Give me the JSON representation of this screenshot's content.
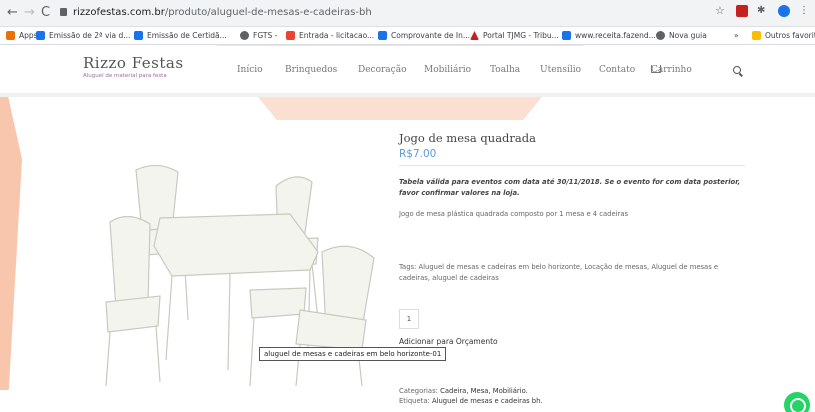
{
  "browser": {
    "url_domain": "rizzofestas.com.br",
    "url_path": "/produto/aluguel-de-mesas-e-cadeiras-bh",
    "bookmarks": [
      {
        "label": "Apps",
        "color": "#4285f4"
      },
      {
        "label": "Emissão de 2ª via d...",
        "color": "#1a73e8"
      },
      {
        "label": "Emissão de Certidã...",
        "color": "#1a73e8"
      },
      {
        "label": "FGTS -",
        "color": "#5f6368"
      },
      {
        "label": "Entrada - licitacao...",
        "color": "#ea4335"
      },
      {
        "label": "Comprovante de In...",
        "color": "#1a73e8"
      },
      {
        "label": "Portal TJMG - Tribu...",
        "color": "#c5221f"
      },
      {
        "label": "www.receita.fazend...",
        "color": "#1a73e8"
      },
      {
        "label": "Nova guia",
        "color": "#5f6368"
      },
      {
        "label": "»",
        "color": "#5f6368"
      },
      {
        "label": "Outros favoritos",
        "color": "#fbbc04"
      }
    ]
  },
  "site": {
    "logo_text": "Rizzo Festas",
    "logo_tagline": "Aluguel de material para festa",
    "menu": [
      "Início",
      "Brinquedos",
      "Decoração",
      "Mobiliário",
      "Toalha",
      "Utensílio",
      "Contato",
      "Carrinho"
    ]
  },
  "product": {
    "title": "Jogo de mesa quadrada",
    "price": "R$7.00",
    "notice": "Tabela válida para eventos com data até 30/11/2018. Se o evento for com data posterior, favor confirmar valores na loja.",
    "description": "Jogo de mesa plástica quadrada composto por 1 mesa e 4 cadeiras",
    "tags": "Tags: Aluguel de mesas e cadeiras em belo horizonte, Locação de mesas, Aluguel de mesas e cadeiras, aluguel de cadeiras",
    "quantity": "1",
    "add_label": "Adicionar para Orçamento",
    "tooltip": "aluguel de mesas e cadeiras em belo horizonte-01",
    "categories_label": "Categorias:",
    "categories_value": "Cadeira, Mesa, Mobiliário.",
    "tag_label": "Etiqueta:",
    "tag_value": "Aluguel de mesas e cadeiras bh."
  },
  "colors": {
    "accent_price": "#5b9bd5",
    "deco_peach": "#f8c6ad",
    "whatsapp": "#25d366"
  }
}
